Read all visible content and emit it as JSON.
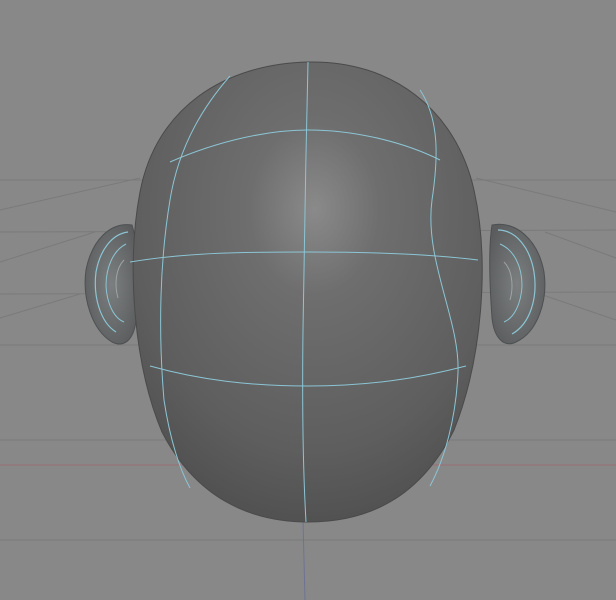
{
  "viewport": {
    "background_color": "#888888",
    "grid_color": "#7a7a7a",
    "axis_x_color": "#9c6e75",
    "axis_z_color": "#6e7394",
    "mesh_body_color": "#626262",
    "mesh_shadow_color": "#4e4e4e",
    "mesh_highlight_color": "#8a8a8a",
    "wire_color": "#8cc5d4",
    "ear_color": "#6a6c6d",
    "grid_visible": true,
    "object": "head-mesh"
  }
}
